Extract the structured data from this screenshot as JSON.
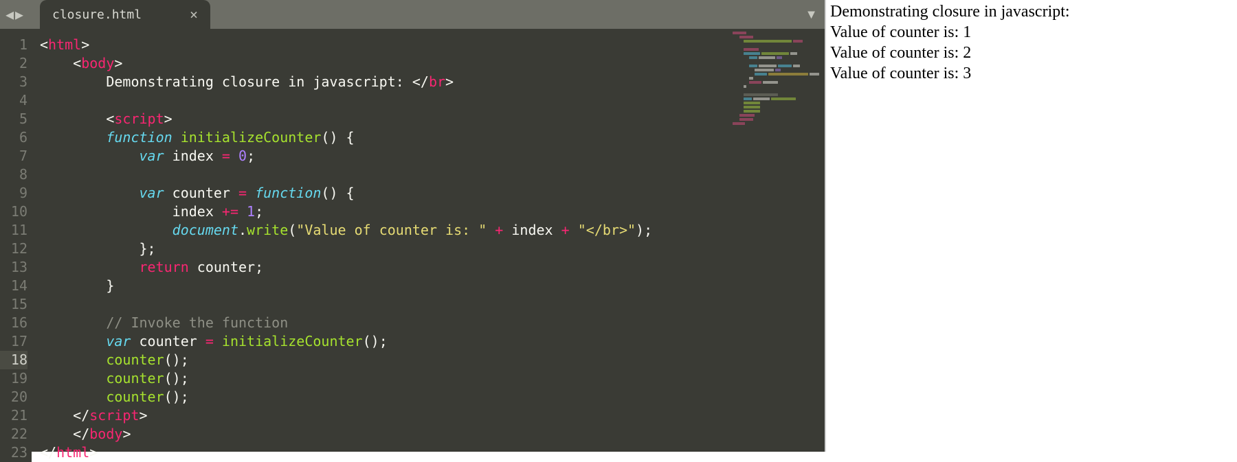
{
  "tabs": {
    "active": {
      "title": "closure.html"
    }
  },
  "editor": {
    "active_line": 18,
    "line_count": 23,
    "lines": [
      {
        "indent": 0,
        "tokens": [
          [
            "c-punct",
            "<"
          ],
          [
            "c-tag",
            "html"
          ],
          [
            "c-punct",
            ">"
          ]
        ]
      },
      {
        "indent": 1,
        "tokens": [
          [
            "c-punct",
            "<"
          ],
          [
            "c-tag",
            "body"
          ],
          [
            "c-punct",
            ">"
          ]
        ]
      },
      {
        "indent": 2,
        "tokens": [
          [
            "c-var",
            "Demonstrating closure in javascript: "
          ],
          [
            "c-punct",
            "</"
          ],
          [
            "c-tag",
            "br"
          ],
          [
            "c-punct",
            ">"
          ]
        ]
      },
      {
        "indent": 0,
        "tokens": []
      },
      {
        "indent": 2,
        "tokens": [
          [
            "c-punct",
            "<"
          ],
          [
            "c-tag",
            "script"
          ],
          [
            "c-punct",
            ">"
          ]
        ]
      },
      {
        "indent": 2,
        "tokens": [
          [
            "c-kw-it",
            "function"
          ],
          [
            "c-var",
            " "
          ],
          [
            "c-fn",
            "initializeCounter"
          ],
          [
            "c-punct",
            "() {"
          ]
        ]
      },
      {
        "indent": 3,
        "tokens": [
          [
            "c-kw-it",
            "var"
          ],
          [
            "c-var",
            " index "
          ],
          [
            "c-op",
            "="
          ],
          [
            "c-var",
            " "
          ],
          [
            "c-num",
            "0"
          ],
          [
            "c-punct",
            ";"
          ]
        ]
      },
      {
        "indent": 0,
        "tokens": []
      },
      {
        "indent": 3,
        "tokens": [
          [
            "c-kw-it",
            "var"
          ],
          [
            "c-var",
            " counter "
          ],
          [
            "c-op",
            "="
          ],
          [
            "c-var",
            " "
          ],
          [
            "c-kw-it",
            "function"
          ],
          [
            "c-punct",
            "() {"
          ]
        ]
      },
      {
        "indent": 4,
        "tokens": [
          [
            "c-var",
            "index "
          ],
          [
            "c-op",
            "+="
          ],
          [
            "c-var",
            " "
          ],
          [
            "c-num",
            "1"
          ],
          [
            "c-punct",
            ";"
          ]
        ]
      },
      {
        "indent": 4,
        "tokens": [
          [
            "c-obj",
            "document"
          ],
          [
            "c-punct",
            "."
          ],
          [
            "c-fn",
            "write"
          ],
          [
            "c-punct",
            "("
          ],
          [
            "c-str",
            "\"Value of counter is: \""
          ],
          [
            "c-var",
            " "
          ],
          [
            "c-op",
            "+"
          ],
          [
            "c-var",
            " index "
          ],
          [
            "c-op",
            "+"
          ],
          [
            "c-var",
            " "
          ],
          [
            "c-str",
            "\"</br>\""
          ],
          [
            "c-punct",
            ");"
          ]
        ]
      },
      {
        "indent": 3,
        "tokens": [
          [
            "c-punct",
            "};"
          ]
        ]
      },
      {
        "indent": 3,
        "tokens": [
          [
            "c-kw",
            "return"
          ],
          [
            "c-var",
            " counter"
          ],
          [
            "c-punct",
            ";"
          ]
        ]
      },
      {
        "indent": 2,
        "tokens": [
          [
            "c-punct",
            "}"
          ]
        ]
      },
      {
        "indent": 0,
        "tokens": []
      },
      {
        "indent": 2,
        "tokens": [
          [
            "c-comm",
            "// Invoke the function"
          ]
        ]
      },
      {
        "indent": 2,
        "tokens": [
          [
            "c-kw-it",
            "var"
          ],
          [
            "c-var",
            " counter "
          ],
          [
            "c-op",
            "="
          ],
          [
            "c-var",
            " "
          ],
          [
            "c-fn",
            "initializeCounter"
          ],
          [
            "c-punct",
            "();"
          ]
        ]
      },
      {
        "indent": 2,
        "tokens": [
          [
            "c-fn",
            "counter"
          ],
          [
            "c-punct",
            "();"
          ]
        ]
      },
      {
        "indent": 2,
        "tokens": [
          [
            "c-fn",
            "counter"
          ],
          [
            "c-punct",
            "();"
          ]
        ]
      },
      {
        "indent": 2,
        "tokens": [
          [
            "c-fn",
            "counter"
          ],
          [
            "c-punct",
            "();"
          ]
        ]
      },
      {
        "indent": 1,
        "tokens": [
          [
            "c-punct",
            "</"
          ],
          [
            "c-tag",
            "script"
          ],
          [
            "c-punct",
            ">"
          ]
        ]
      },
      {
        "indent": 1,
        "tokens": [
          [
            "c-punct",
            "</"
          ],
          [
            "c-tag",
            "body"
          ],
          [
            "c-punct",
            ">"
          ]
        ]
      },
      {
        "indent": 0,
        "tokens": [
          [
            "c-punct",
            "</"
          ],
          [
            "c-tag",
            "html"
          ],
          [
            "c-punct",
            ">"
          ]
        ]
      }
    ]
  },
  "output": {
    "lines": [
      "Demonstrating closure in javascript:",
      "Value of counter is: 1",
      "Value of counter is: 2",
      "Value of counter is: 3"
    ]
  }
}
